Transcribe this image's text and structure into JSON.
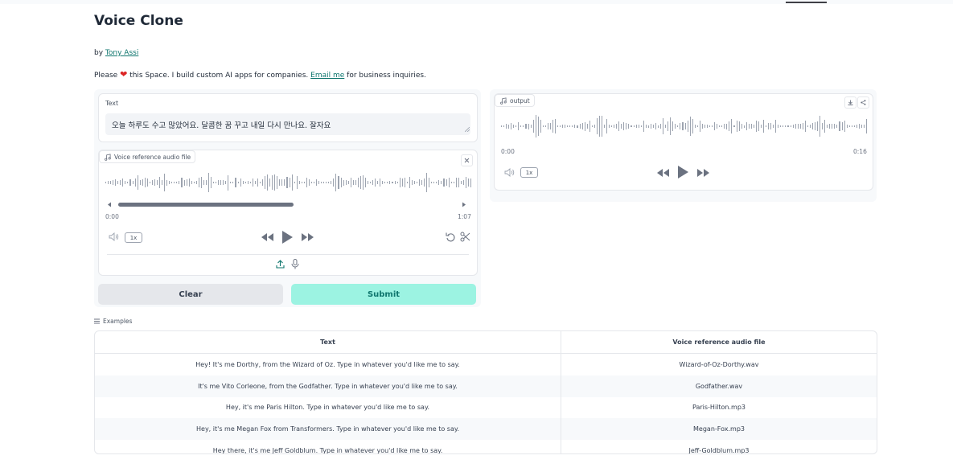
{
  "header": {
    "title": "Voice Clone",
    "by_prefix": "by",
    "author": "Tony Assi",
    "please": "Please",
    "heart": "❤",
    "space_text": "this Space. I build custom AI apps for companies.",
    "email_link": "Email me",
    "business_text": "for business inquiries."
  },
  "input": {
    "text_label": "Text",
    "text_value": "오늘 하루도 수고 많았어요. 달콤한 꿈 꾸고 내일 다시 만나요. 잘자요",
    "ref_label": "Voice reference audio file",
    "ref_time_start": "0:00",
    "ref_time_end": "1:07",
    "ref_speed": "1x",
    "clear_label": "Clear",
    "submit_label": "Submit"
  },
  "output": {
    "label": "output",
    "time_start": "0:00",
    "time_end": "0:16",
    "speed": "1x"
  },
  "examples": {
    "label": "Examples",
    "columns": [
      "Text",
      "Voice reference audio file"
    ],
    "rows": [
      [
        "Hey! It's me Dorthy, from the Wizard of Oz. Type in whatever you'd like me to say.",
        "Wizard-of-Oz-Dorthy.wav"
      ],
      [
        "It's me Vito Corleone, from the Godfather. Type in whatever you'd like me to say.",
        "Godfather.wav"
      ],
      [
        "Hey, it's me Paris Hilton. Type in whatever you'd like me to say.",
        "Paris-Hilton.mp3"
      ],
      [
        "Hey, it's me Megan Fox from Transformers. Type in whatever you'd like me to say.",
        "Megan-Fox.mp3"
      ],
      [
        "Hey there, it's me Jeff Goldblum. Type in whatever you'd like me to say.",
        "Jeff-Goldblum.mp3"
      ]
    ]
  },
  "icons": {
    "music": "music-note-icon",
    "close": "close-icon",
    "volume": "volume-icon",
    "rewind": "rewind-icon",
    "play": "play-icon",
    "forward": "fast-forward-icon",
    "undo": "undo-icon",
    "trim": "scissors-icon",
    "upload": "upload-icon",
    "mic": "microphone-icon",
    "download": "download-icon",
    "share": "share-icon",
    "list": "list-icon"
  },
  "colors": {
    "accent": "#9cf3e2",
    "accent_text": "#0f766e",
    "link": "#0f766e",
    "waveform": "#9ca3af"
  }
}
